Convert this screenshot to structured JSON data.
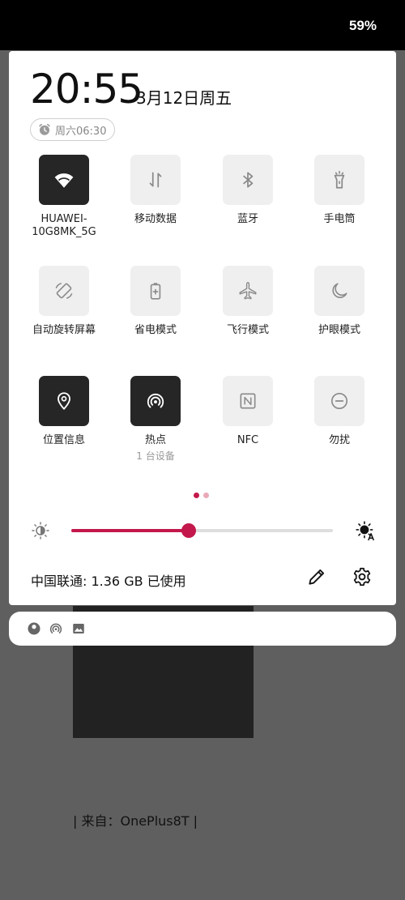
{
  "status_bar": {
    "battery": "59%"
  },
  "panel": {
    "time": "20:55",
    "date": "3月12日周五",
    "alarm": "周六06:30"
  },
  "tiles": [
    {
      "label": "HUAWEI-10G8MK_5G",
      "icon": "wifi-icon",
      "active": true
    },
    {
      "label": "移动数据",
      "icon": "mobile-data-icon",
      "active": false
    },
    {
      "label": "蓝牙",
      "icon": "bluetooth-icon",
      "active": false
    },
    {
      "label": "手电筒",
      "icon": "flashlight-icon",
      "active": false
    },
    {
      "label": "自动旋转屏幕",
      "icon": "auto-rotate-icon",
      "active": false
    },
    {
      "label": "省电模式",
      "icon": "battery-saver-icon",
      "active": false
    },
    {
      "label": "飞行模式",
      "icon": "airplane-icon",
      "active": false
    },
    {
      "label": "护眼模式",
      "icon": "moon-icon",
      "active": false
    },
    {
      "label": "位置信息",
      "icon": "location-icon",
      "active": true
    },
    {
      "label": "热点",
      "sub": "1 台设备",
      "icon": "hotspot-icon",
      "active": true
    },
    {
      "label": "NFC",
      "icon": "nfc-icon",
      "active": false
    },
    {
      "label": "勿扰",
      "icon": "do-not-disturb-icon",
      "active": false
    }
  ],
  "pager": {
    "pages": 2,
    "current": 1
  },
  "brightness": {
    "level": 0.45
  },
  "footer": {
    "carrier": "中国联通: 1.36 GB 已使用"
  },
  "notifications": {
    "icons": [
      "face-icon",
      "hotspot-icon",
      "image-icon"
    ]
  },
  "background_app": {
    "text": "| 来自：OnePlus8T |"
  },
  "colors": {
    "accent": "#c2184b",
    "tile_on": "#262626",
    "tile_off": "#efefef"
  }
}
